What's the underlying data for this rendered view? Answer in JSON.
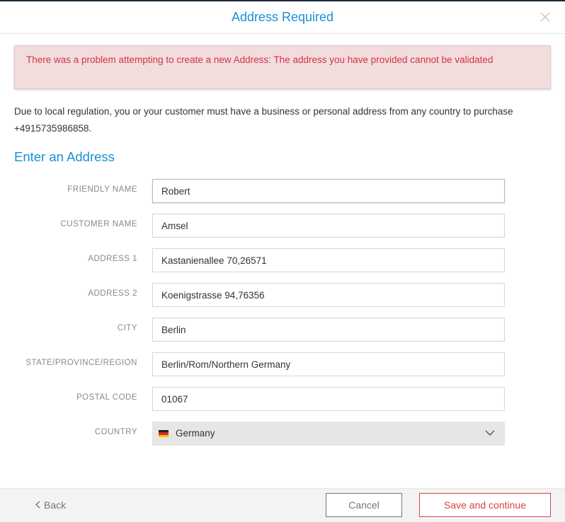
{
  "header": {
    "title": "Address Required",
    "close_icon": "close-icon"
  },
  "error": {
    "message": "There was a problem attempting to create a new Address: The address you have provided cannot be validated"
  },
  "intro": {
    "text": "Due to local regulation, you or your customer must have a business or personal address from any country to purchase +4915735986858."
  },
  "form": {
    "section_title": "Enter an Address",
    "friendly_name": {
      "label": "FRIENDLY NAME",
      "value": "Robert"
    },
    "customer_name": {
      "label": "CUSTOMER NAME",
      "value": "Amsel"
    },
    "address1": {
      "label": "ADDRESS 1",
      "value": "Kastanienallee 70,26571"
    },
    "address2": {
      "label": "ADDRESS 2",
      "value": "Koenigstrasse 94,76356"
    },
    "city": {
      "label": "CITY",
      "value": "Berlin"
    },
    "state": {
      "label": "STATE/PROVINCE/REGION",
      "value": "Berlin/Rom/Northern Germany"
    },
    "postal_code": {
      "label": "POSTAL CODE",
      "value": "01067"
    },
    "country": {
      "label": "COUNTRY",
      "value": "Germany",
      "flag_icon": "germany-flag-icon",
      "chevron_icon": "chevron-down-icon"
    }
  },
  "footer": {
    "back_label": "Back",
    "cancel_label": "Cancel",
    "save_label": "Save and continue"
  },
  "colors": {
    "accent_blue": "#1a8fd6",
    "error_text": "#d0344a",
    "error_bg": "#f2dcdc",
    "save_red": "#d64545"
  }
}
